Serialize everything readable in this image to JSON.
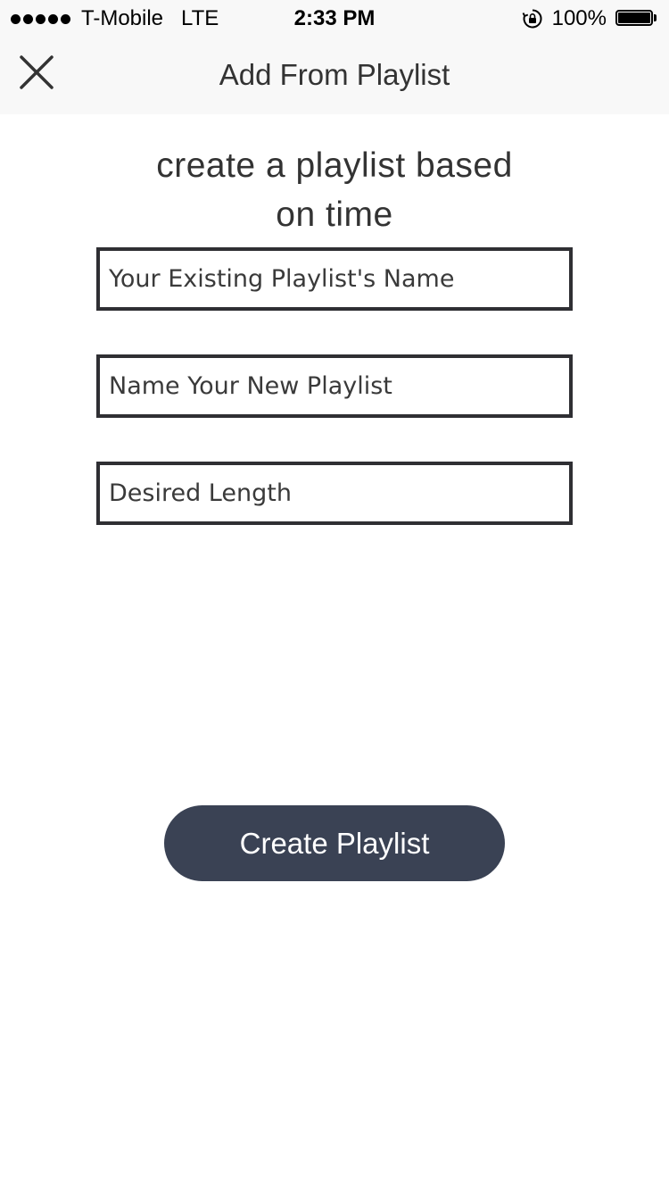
{
  "status_bar": {
    "carrier": "T-Mobile",
    "network": "LTE",
    "time": "2:33 PM",
    "battery": "100%",
    "battery_level": 1.0,
    "signal_bars": 5
  },
  "nav": {
    "title": "Add From Playlist",
    "close_icon": "close-icon"
  },
  "content": {
    "headline_line1": "create a playlist based",
    "headline_line2": "on time",
    "fields": [
      {
        "placeholder": "Your Existing Playlist's Name",
        "value": ""
      },
      {
        "placeholder": "Name Your New Playlist",
        "value": ""
      },
      {
        "placeholder": "Desired Length",
        "value": ""
      }
    ],
    "create_button_label": "Create Playlist"
  },
  "colors": {
    "button_bg": "#3a4254",
    "field_border": "#2f2f33",
    "bar_bg": "#f8f8f8"
  }
}
